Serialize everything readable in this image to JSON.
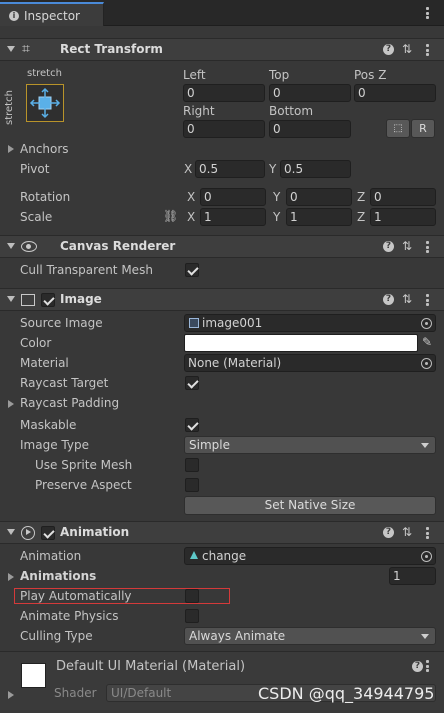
{
  "tab": {
    "title": "Inspector",
    "icon": "info-icon"
  },
  "rect_transform": {
    "title": "Rect Transform",
    "anchor_preset_label": "stretch",
    "anchor_preset_vertical": "stretch",
    "col_labels": [
      "Left",
      "Top",
      "Pos Z"
    ],
    "col_values": [
      "0",
      "0",
      "0"
    ],
    "row2_labels": [
      "Right",
      "Bottom"
    ],
    "row2_values": [
      "0",
      "0"
    ],
    "r_button": "R",
    "anchors_label": "Anchors",
    "pivot_label": "Pivot",
    "pivot": {
      "x_label": "X",
      "x": "0.5",
      "y_label": "Y",
      "y": "0.5"
    },
    "rotation_label": "Rotation",
    "rotation": {
      "x": "0",
      "y": "0",
      "z": "0"
    },
    "scale_label": "Scale",
    "scale": {
      "x": "1",
      "y": "1",
      "z": "1"
    },
    "axis": {
      "x": "X",
      "y": "Y",
      "z": "Z"
    }
  },
  "canvas_renderer": {
    "title": "Canvas Renderer",
    "cull_label": "Cull Transparent Mesh",
    "cull_checked": true
  },
  "image": {
    "title": "Image",
    "source_image_label": "Source Image",
    "source_image_value": "image001",
    "color_label": "Color",
    "color_value": "#ffffff",
    "material_label": "Material",
    "material_value": "None (Material)",
    "raycast_target_label": "Raycast Target",
    "raycast_padding_label": "Raycast Padding",
    "maskable_label": "Maskable",
    "image_type_label": "Image Type",
    "image_type_value": "Simple",
    "use_sprite_mesh_label": "Use Sprite Mesh",
    "preserve_aspect_label": "Preserve Aspect",
    "native_size_button": "Set Native Size"
  },
  "animation": {
    "title": "Animation",
    "animation_label": "Animation",
    "animation_value": "change",
    "animations_label": "Animations",
    "animations_count": "1",
    "play_auto_label": "Play Automatically",
    "animate_physics_label": "Animate Physics",
    "culling_type_label": "Culling Type",
    "culling_type_value": "Always Animate"
  },
  "material": {
    "title": "Default UI Material (Material)",
    "shader_label": "Shader",
    "shader_value": "UI/Default"
  },
  "watermark": "CSDN @qq_34944795"
}
